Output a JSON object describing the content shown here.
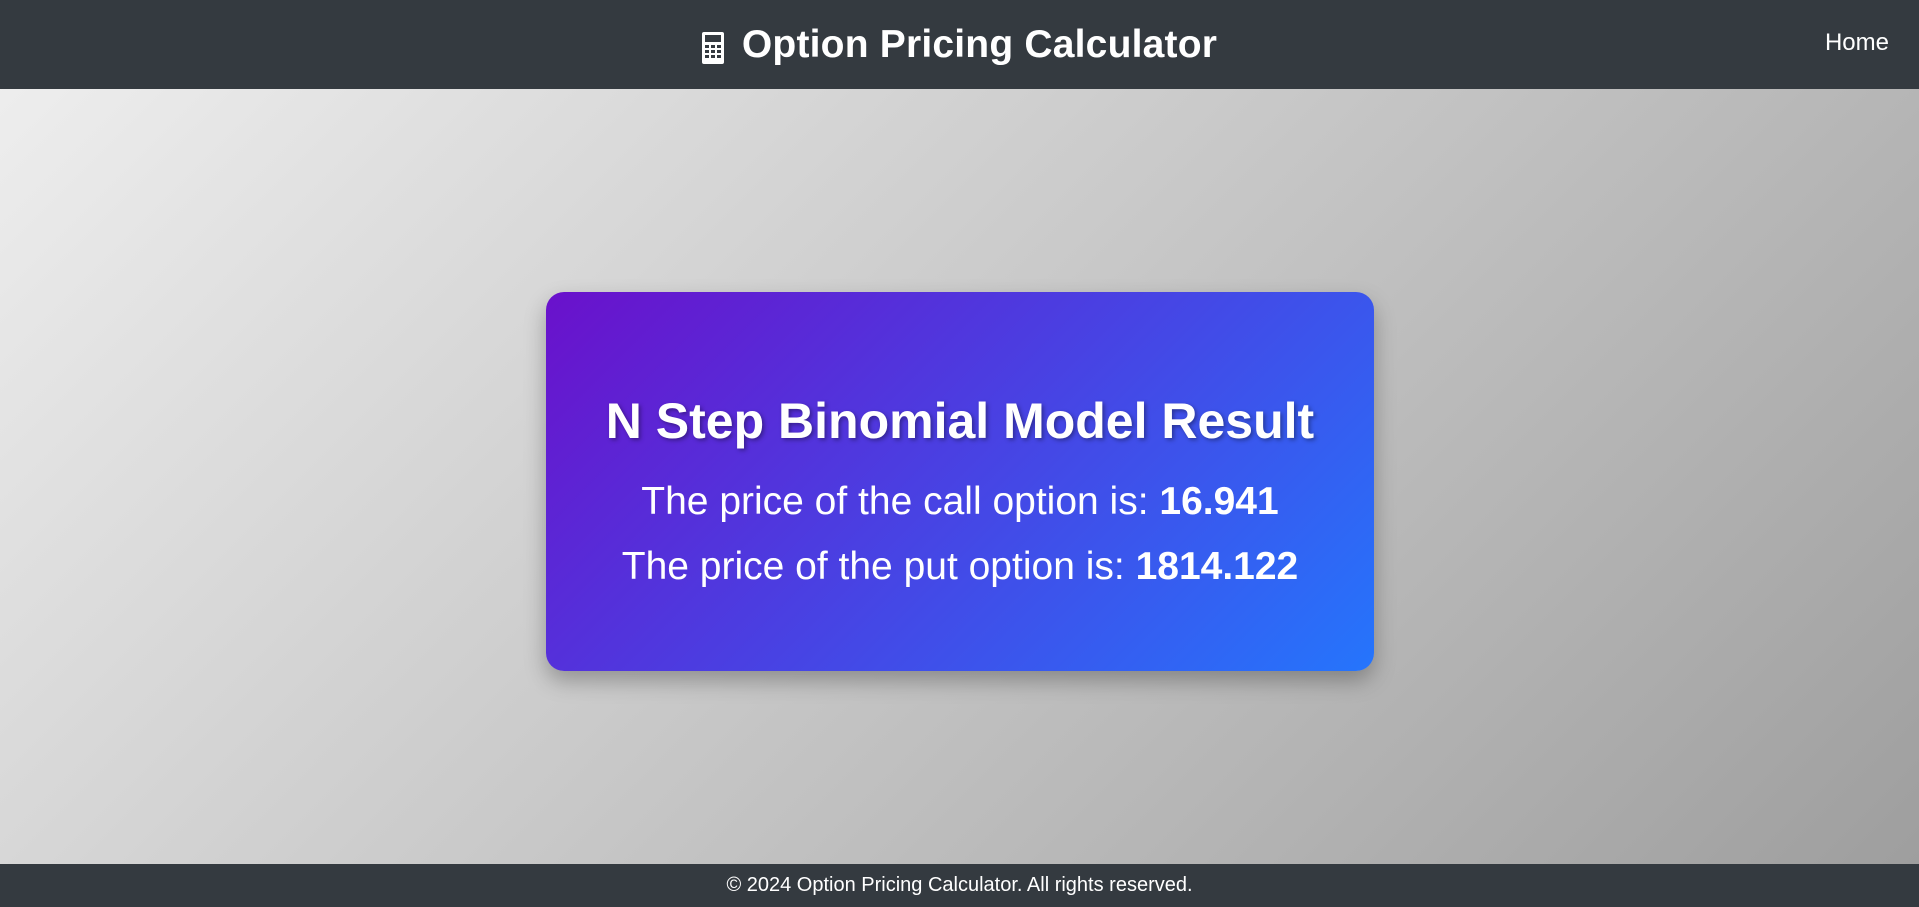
{
  "header": {
    "icon": "calculator-icon",
    "title": "Option Pricing Calculator",
    "nav_home": "Home"
  },
  "result_card": {
    "title": "N Step Binomial Model Result",
    "call_label": "The price of the call option is:",
    "call_value": "16.941",
    "put_label": "The price of the put option is:",
    "put_value": "1814.122"
  },
  "footer": {
    "copyright": "© 2024 Option Pricing Calculator. All rights reserved."
  },
  "colors": {
    "header_bg": "#343a40",
    "card_gradient_start": "#6a11cb",
    "card_gradient_end": "#2575fc"
  }
}
